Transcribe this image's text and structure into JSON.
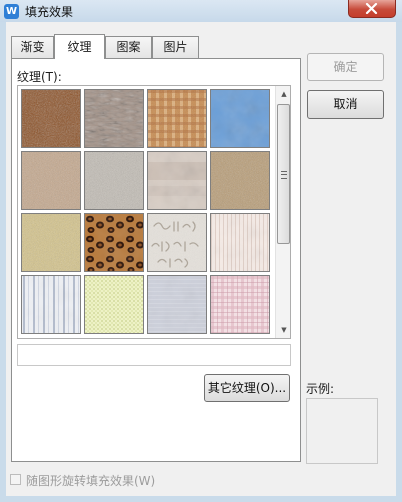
{
  "window": {
    "title": "填充效果",
    "app_icon": "W"
  },
  "tabs": [
    {
      "label": "渐变",
      "active": false
    },
    {
      "label": "纹理",
      "active": true
    },
    {
      "label": "图案",
      "active": false
    },
    {
      "label": "图片",
      "active": false
    }
  ],
  "texture": {
    "label": "纹理(T):",
    "name_value": "",
    "other_button": "其它纹理(O)...",
    "swatches": [
      "brown-leather",
      "gray-marble",
      "woven-burlap",
      "blue-tissue",
      "tan-granite",
      "gray-granite",
      "beige-fabric",
      "brown-sand",
      "yellow-sand",
      "leopard-fur",
      "office-stamp",
      "pink-tissue",
      "blue-stripe",
      "green-canvas",
      "gray-denim",
      "pink-plaid"
    ]
  },
  "buttons": {
    "ok": "确定",
    "cancel": "取消"
  },
  "preview": {
    "label": "示例:"
  },
  "rotate": {
    "label": "随图形旋转填充效果(W)",
    "checked": false
  },
  "colors": {
    "titlebar": "#c9dbea",
    "close": "#c74b3a",
    "dialog": "#f0f0f0"
  }
}
